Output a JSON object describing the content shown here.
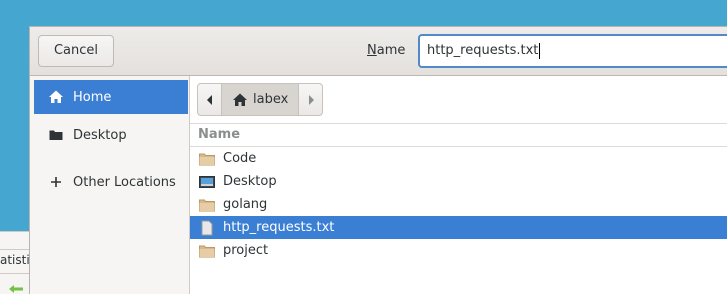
{
  "background_window": {
    "partial_text": "atistic"
  },
  "dialog": {
    "cancel_label": "Cancel",
    "name_label_mnemonic": "N",
    "name_label_rest": "ame",
    "filename_value": "http_requests.txt"
  },
  "sidebar": {
    "items": [
      {
        "label": "Home",
        "icon": "home-icon",
        "selected": true
      },
      {
        "label": "Desktop",
        "icon": "folder-icon",
        "selected": false
      },
      {
        "label": "Other Locations",
        "icon": "plus-icon",
        "selected": false
      }
    ]
  },
  "pathbar": {
    "crumb": "labex"
  },
  "file_list": {
    "column_name": "Name",
    "rows": [
      {
        "name": "Code",
        "icon": "folder-icon",
        "selected": false
      },
      {
        "name": "Desktop",
        "icon": "desktop-folder-icon",
        "selected": false
      },
      {
        "name": "golang",
        "icon": "folder-icon",
        "selected": false
      },
      {
        "name": "http_requests.txt",
        "icon": "text-file-icon",
        "selected": true
      },
      {
        "name": "project",
        "icon": "folder-icon",
        "selected": false
      }
    ]
  },
  "colors": {
    "desktop_bg": "#45a7cf",
    "selection": "#3b7fd4",
    "focus_border": "#5289c9",
    "folder": "#d9b98a"
  }
}
